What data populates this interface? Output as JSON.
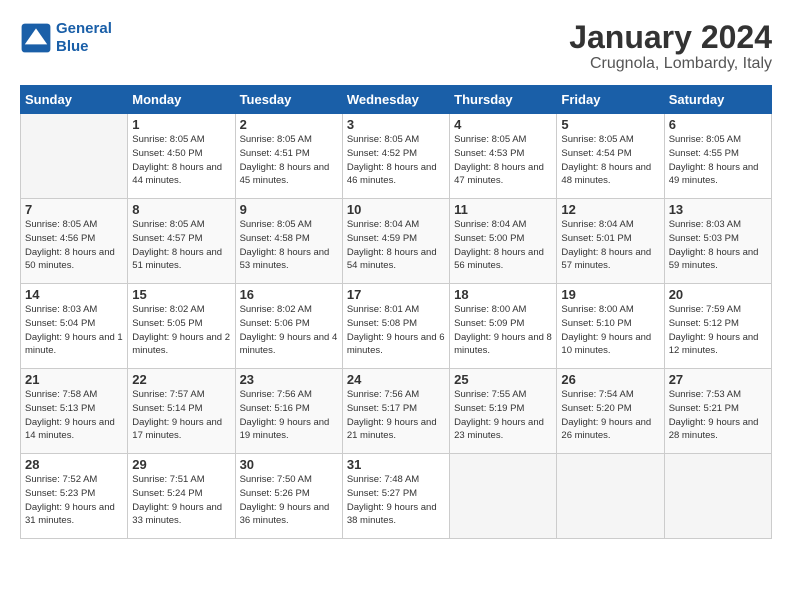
{
  "header": {
    "logo_line1": "General",
    "logo_line2": "Blue",
    "title": "January 2024",
    "subtitle": "Crugnola, Lombardy, Italy"
  },
  "days_of_week": [
    "Sunday",
    "Monday",
    "Tuesday",
    "Wednesday",
    "Thursday",
    "Friday",
    "Saturday"
  ],
  "weeks": [
    [
      {
        "day": "",
        "empty": true
      },
      {
        "day": "1",
        "sunrise": "8:05 AM",
        "sunset": "4:50 PM",
        "daylight": "8 hours and 44 minutes."
      },
      {
        "day": "2",
        "sunrise": "8:05 AM",
        "sunset": "4:51 PM",
        "daylight": "8 hours and 45 minutes."
      },
      {
        "day": "3",
        "sunrise": "8:05 AM",
        "sunset": "4:52 PM",
        "daylight": "8 hours and 46 minutes."
      },
      {
        "day": "4",
        "sunrise": "8:05 AM",
        "sunset": "4:53 PM",
        "daylight": "8 hours and 47 minutes."
      },
      {
        "day": "5",
        "sunrise": "8:05 AM",
        "sunset": "4:54 PM",
        "daylight": "8 hours and 48 minutes."
      },
      {
        "day": "6",
        "sunrise": "8:05 AM",
        "sunset": "4:55 PM",
        "daylight": "8 hours and 49 minutes."
      }
    ],
    [
      {
        "day": "7",
        "sunrise": "8:05 AM",
        "sunset": "4:56 PM",
        "daylight": "8 hours and 50 minutes."
      },
      {
        "day": "8",
        "sunrise": "8:05 AM",
        "sunset": "4:57 PM",
        "daylight": "8 hours and 51 minutes."
      },
      {
        "day": "9",
        "sunrise": "8:05 AM",
        "sunset": "4:58 PM",
        "daylight": "8 hours and 53 minutes."
      },
      {
        "day": "10",
        "sunrise": "8:04 AM",
        "sunset": "4:59 PM",
        "daylight": "8 hours and 54 minutes."
      },
      {
        "day": "11",
        "sunrise": "8:04 AM",
        "sunset": "5:00 PM",
        "daylight": "8 hours and 56 minutes."
      },
      {
        "day": "12",
        "sunrise": "8:04 AM",
        "sunset": "5:01 PM",
        "daylight": "8 hours and 57 minutes."
      },
      {
        "day": "13",
        "sunrise": "8:03 AM",
        "sunset": "5:03 PM",
        "daylight": "8 hours and 59 minutes."
      }
    ],
    [
      {
        "day": "14",
        "sunrise": "8:03 AM",
        "sunset": "5:04 PM",
        "daylight": "9 hours and 1 minute."
      },
      {
        "day": "15",
        "sunrise": "8:02 AM",
        "sunset": "5:05 PM",
        "daylight": "9 hours and 2 minutes."
      },
      {
        "day": "16",
        "sunrise": "8:02 AM",
        "sunset": "5:06 PM",
        "daylight": "9 hours and 4 minutes."
      },
      {
        "day": "17",
        "sunrise": "8:01 AM",
        "sunset": "5:08 PM",
        "daylight": "9 hours and 6 minutes."
      },
      {
        "day": "18",
        "sunrise": "8:00 AM",
        "sunset": "5:09 PM",
        "daylight": "9 hours and 8 minutes."
      },
      {
        "day": "19",
        "sunrise": "8:00 AM",
        "sunset": "5:10 PM",
        "daylight": "9 hours and 10 minutes."
      },
      {
        "day": "20",
        "sunrise": "7:59 AM",
        "sunset": "5:12 PM",
        "daylight": "9 hours and 12 minutes."
      }
    ],
    [
      {
        "day": "21",
        "sunrise": "7:58 AM",
        "sunset": "5:13 PM",
        "daylight": "9 hours and 14 minutes."
      },
      {
        "day": "22",
        "sunrise": "7:57 AM",
        "sunset": "5:14 PM",
        "daylight": "9 hours and 17 minutes."
      },
      {
        "day": "23",
        "sunrise": "7:56 AM",
        "sunset": "5:16 PM",
        "daylight": "9 hours and 19 minutes."
      },
      {
        "day": "24",
        "sunrise": "7:56 AM",
        "sunset": "5:17 PM",
        "daylight": "9 hours and 21 minutes."
      },
      {
        "day": "25",
        "sunrise": "7:55 AM",
        "sunset": "5:19 PM",
        "daylight": "9 hours and 23 minutes."
      },
      {
        "day": "26",
        "sunrise": "7:54 AM",
        "sunset": "5:20 PM",
        "daylight": "9 hours and 26 minutes."
      },
      {
        "day": "27",
        "sunrise": "7:53 AM",
        "sunset": "5:21 PM",
        "daylight": "9 hours and 28 minutes."
      }
    ],
    [
      {
        "day": "28",
        "sunrise": "7:52 AM",
        "sunset": "5:23 PM",
        "daylight": "9 hours and 31 minutes."
      },
      {
        "day": "29",
        "sunrise": "7:51 AM",
        "sunset": "5:24 PM",
        "daylight": "9 hours and 33 minutes."
      },
      {
        "day": "30",
        "sunrise": "7:50 AM",
        "sunset": "5:26 PM",
        "daylight": "9 hours and 36 minutes."
      },
      {
        "day": "31",
        "sunrise": "7:48 AM",
        "sunset": "5:27 PM",
        "daylight": "9 hours and 38 minutes."
      },
      {
        "day": "",
        "empty": true
      },
      {
        "day": "",
        "empty": true
      },
      {
        "day": "",
        "empty": true
      }
    ]
  ]
}
